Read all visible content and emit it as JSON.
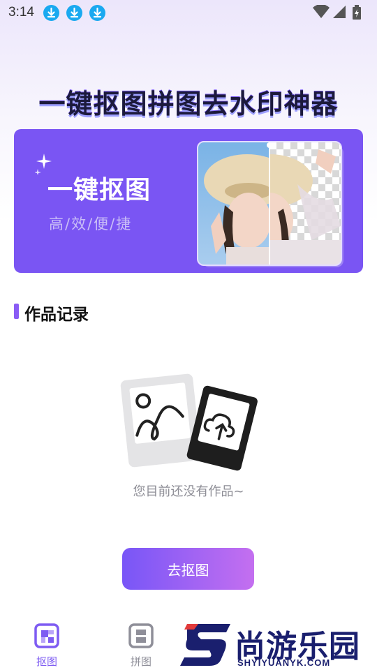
{
  "status_bar": {
    "time": "3:14",
    "download_icons": [
      "download-icon",
      "download-icon",
      "download-icon"
    ],
    "system_icons": [
      "wifi-icon",
      "signal-icon",
      "battery-icon"
    ]
  },
  "headline": "一键抠图拼图去水印神器",
  "banner": {
    "title": "一键抠图",
    "subtitle": "高/效/便/捷",
    "accent_color": "#7a55f3"
  },
  "section": {
    "title": "作品记录"
  },
  "empty_state": {
    "message": "您目前还没有作品~",
    "illustration": "photo-and-upload-icon"
  },
  "action_button": {
    "label": "去抠图"
  },
  "bottom_nav": {
    "items": [
      {
        "label": "抠图",
        "icon": "cutout-icon",
        "active": true
      },
      {
        "label": "拼图",
        "icon": "collage-icon",
        "active": false
      }
    ]
  },
  "watermark": {
    "brand": "尚游乐园",
    "url": "SHYIYUANYK.COM"
  },
  "colors": {
    "primary": "#7e5cf2",
    "gradient_end": "#c46ff0",
    "watermark": "#1a1f6e"
  }
}
